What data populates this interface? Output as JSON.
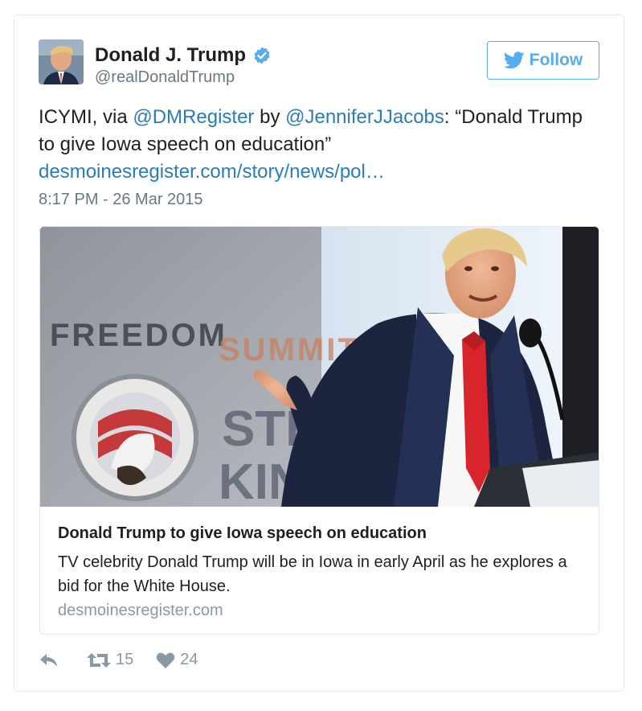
{
  "user": {
    "display_name": "Donald J. Trump",
    "handle": "@realDonaldTrump",
    "verified": true
  },
  "follow_button": {
    "label": "Follow"
  },
  "tweet": {
    "text_prefix": "ICYMI, via ",
    "mention_1": "@DMRegister",
    "text_mid": " by ",
    "mention_2": "@JenniferJJacobs",
    "text_suffix": ": “Donald Trump to give Iowa speech on education”",
    "link": "desmoinesregister.com/story/news/pol…",
    "timestamp": "8:17 PM - 26 Mar 2015"
  },
  "card": {
    "image_sign_text_1": "FREEDOM",
    "image_sign_text_2": "SUMMIT",
    "image_sign_text_3": "STE",
    "image_sign_text_4": "KING",
    "title": "Donald Trump to give Iowa speech on education",
    "description": "TV celebrity Donald Trump will be in Iowa in early April as he explores a bid for the White House.",
    "domain": "desmoinesregister.com"
  },
  "actions": {
    "reply_icon": "reply-icon",
    "retweet_count": "15",
    "like_count": "24"
  },
  "colors": {
    "accent": "#55acee",
    "link": "#2b7bb9",
    "muted": "#697882",
    "border": "#e1e8ed"
  }
}
